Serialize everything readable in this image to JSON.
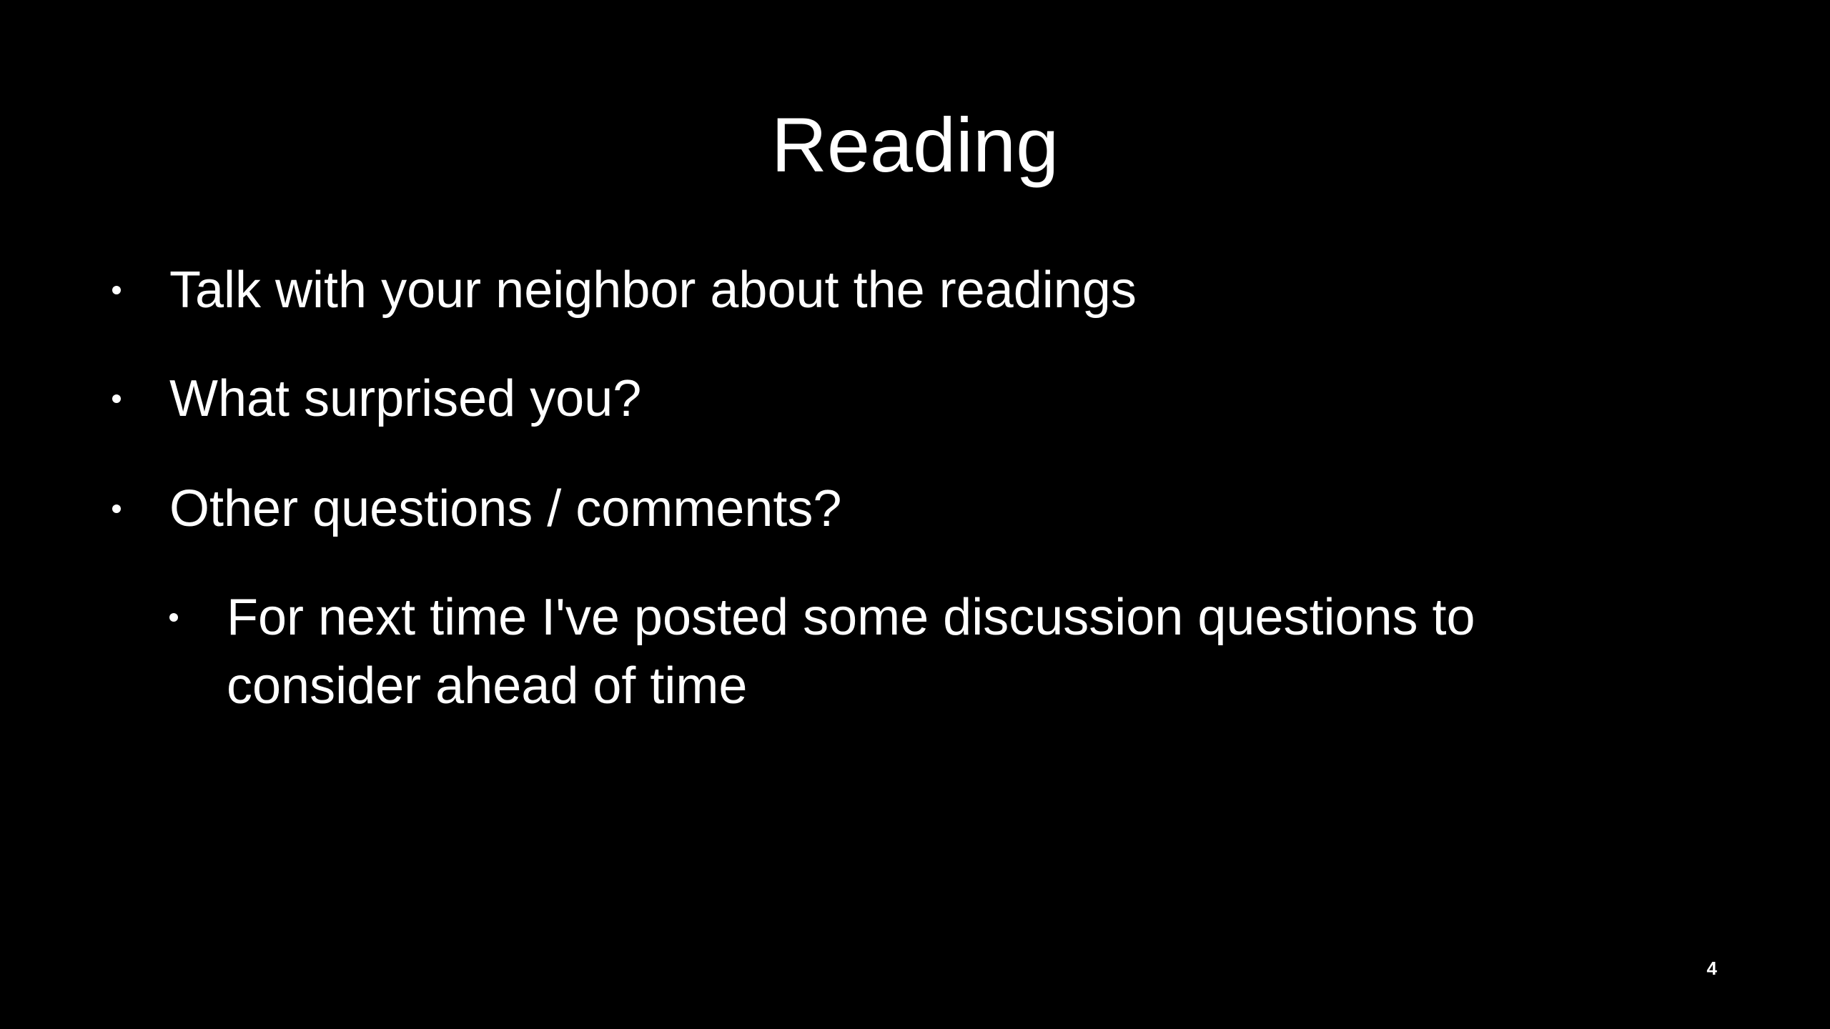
{
  "slide": {
    "title": "Reading",
    "bullets": [
      {
        "text": "Talk with your neighbor about the readings",
        "level": 1
      },
      {
        "text": "What surprised you?",
        "level": 1
      },
      {
        "text": "Other questions / comments?",
        "level": 1
      },
      {
        "text": "For next time I've posted some discussion questions to consider ahead of time",
        "level": 2
      }
    ],
    "page_number": "4"
  },
  "colors": {
    "background": "#000000",
    "text": "#ffffff"
  }
}
